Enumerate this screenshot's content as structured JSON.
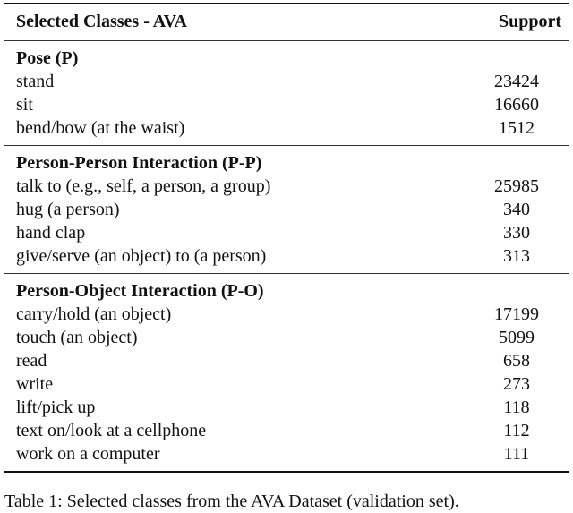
{
  "table": {
    "header": {
      "label": "Selected Classes - AVA",
      "value": "Support"
    },
    "sections": [
      {
        "title": "Pose (P)",
        "rows": [
          {
            "label": "stand",
            "value": "23424"
          },
          {
            "label": "sit",
            "value": "16660"
          },
          {
            "label": "bend/bow (at the waist)",
            "value": "1512"
          }
        ]
      },
      {
        "title": "Person-Person Interaction (P-P)",
        "rows": [
          {
            "label": "talk to (e.g., self, a person, a group)",
            "value": "25985"
          },
          {
            "label": "hug (a person)",
            "value": "340"
          },
          {
            "label": "hand clap",
            "value": "330"
          },
          {
            "label": "give/serve (an object) to (a person)",
            "value": "313"
          }
        ]
      },
      {
        "title": "Person-Object Interaction (P-O)",
        "rows": [
          {
            "label": "carry/hold (an object)",
            "value": "17199"
          },
          {
            "label": "touch (an object)",
            "value": "5099"
          },
          {
            "label": "read",
            "value": "658"
          },
          {
            "label": "write",
            "value": "273"
          },
          {
            "label": "lift/pick up",
            "value": "118"
          },
          {
            "label": "text on/look at a cellphone",
            "value": "112"
          },
          {
            "label": "work on a computer",
            "value": "111"
          }
        ]
      }
    ]
  },
  "caption": "Table 1: Selected classes from the AVA Dataset (validation set)."
}
